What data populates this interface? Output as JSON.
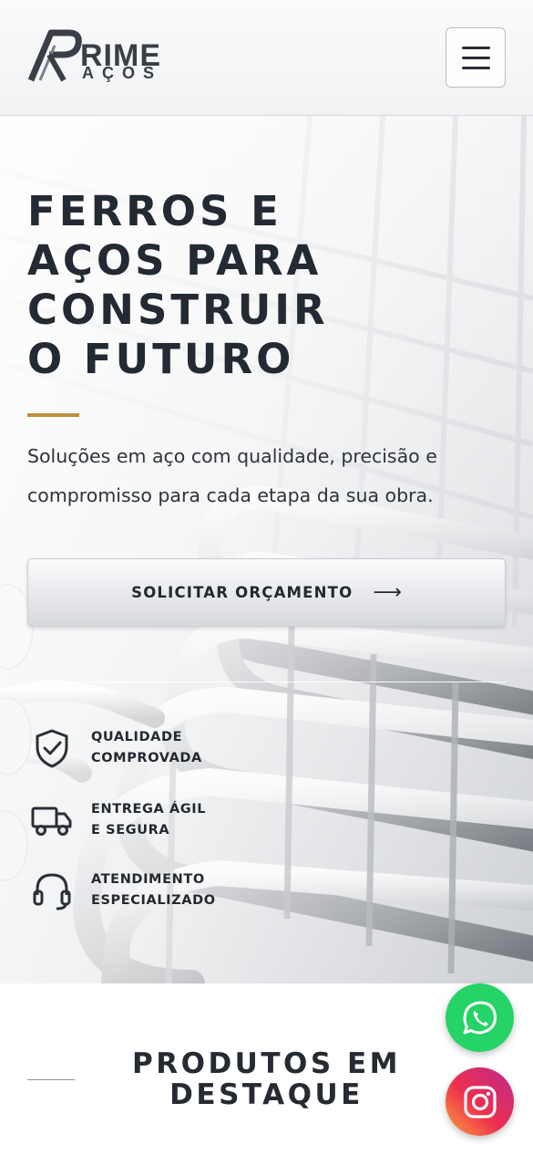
{
  "header": {
    "logo": {
      "word": "RIME",
      "sub": "AÇOS",
      "icon": "prime-logo-icon"
    },
    "menu_icon": "hamburger-menu-icon"
  },
  "hero": {
    "title_lines": [
      "FERROS E",
      "AÇOS PARA",
      "CONSTRUIR",
      "O FUTURO"
    ],
    "subtitle": "Soluções em aço com qualidade, precisão e compromisso para cada etapa da sua obra.",
    "cta": {
      "label": "SOLICITAR ORÇAMENTO",
      "arrow": "⟶",
      "icon": "arrow-right-icon"
    },
    "features": [
      {
        "icon": "shield-check-icon",
        "line1": "QUALIDADE",
        "line2": "COMPROVADA"
      },
      {
        "icon": "truck-icon",
        "line1": "ENTREGA ÁGIL",
        "line2": "E SEGURA"
      },
      {
        "icon": "headset-icon",
        "line1": "ATENDIMENTO",
        "line2": "ESPECIALIZADO"
      }
    ]
  },
  "products": {
    "title_line1": "PRODUTOS EM",
    "title_line2": "DESTAQUE"
  },
  "floating": {
    "whatsapp_icon": "whatsapp-icon",
    "instagram_icon": "instagram-icon"
  },
  "colors": {
    "text_dark": "#242a33",
    "gold_accent": "#bf8f3e",
    "whatsapp": "#25d366",
    "instagram_from": "#f9a13a",
    "instagram_to": "#bc2a8d"
  }
}
